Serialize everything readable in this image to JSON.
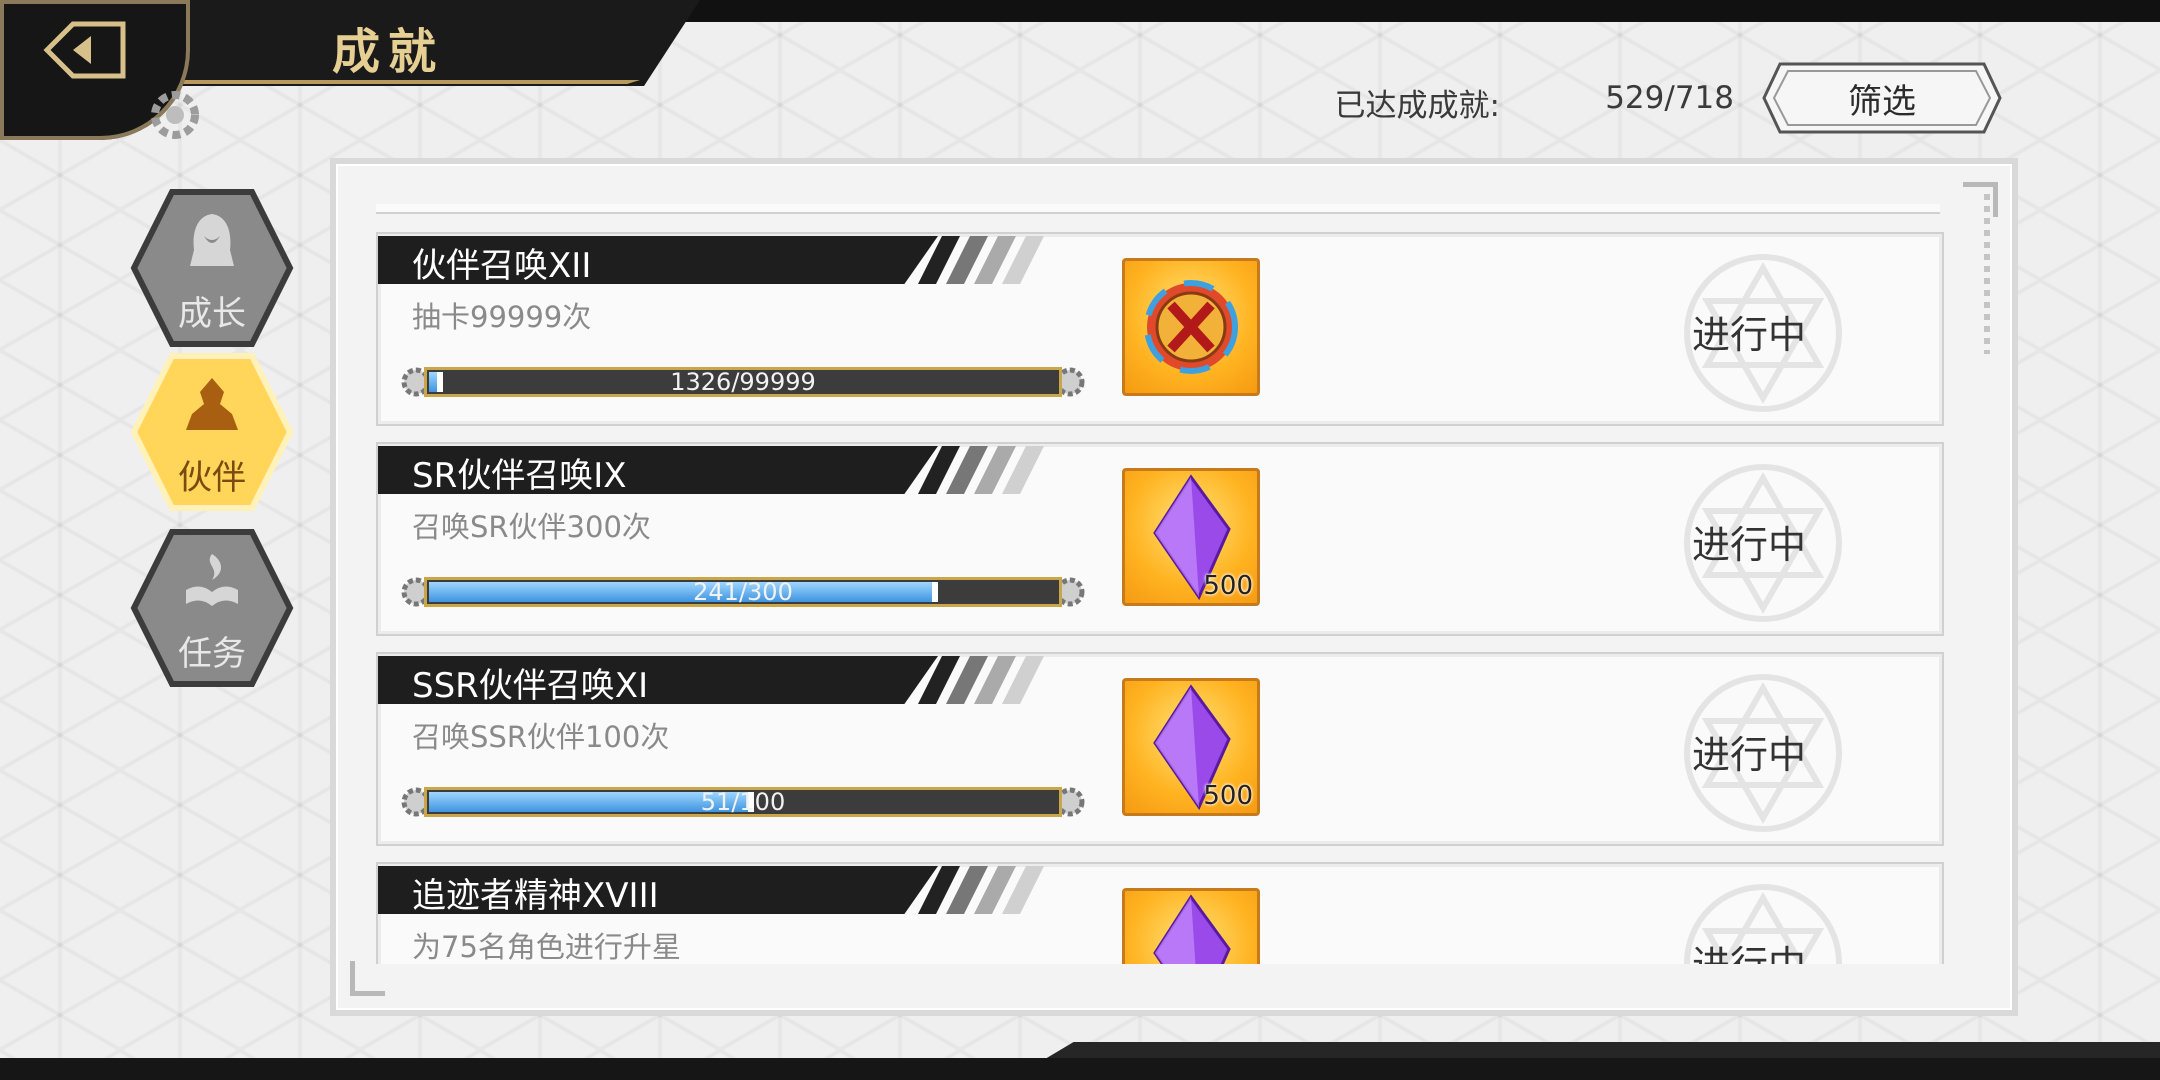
{
  "header": {
    "title": "成就",
    "achievement_label": "已达成成就:",
    "achievement_count": "529/718",
    "filter_label": "筛选"
  },
  "side_tabs": [
    {
      "label": "成长",
      "icon": "hooded-figure-icon",
      "active": false
    },
    {
      "label": "伙伴",
      "icon": "party-group-icon",
      "active": true
    },
    {
      "label": "任务",
      "icon": "book-flame-icon",
      "active": false
    }
  ],
  "achievements": [
    {
      "title": "伙伴召唤XII",
      "desc": "抽卡99999次",
      "progress_text": "1326/99999",
      "progress": 0.013,
      "reward_icon": "rainbow-coin-icon",
      "reward_qty": "",
      "status": "进行中"
    },
    {
      "title": "SR伙伴召唤IX",
      "desc": "召唤SR伙伴300次",
      "progress_text": "241/300",
      "progress": 0.8033,
      "reward_icon": "purple-crystal-icon",
      "reward_qty": "500",
      "status": "进行中"
    },
    {
      "title": "SSR伙伴召唤XI",
      "desc": "召唤SSR伙伴100次",
      "progress_text": "51/100",
      "progress": 0.51,
      "reward_icon": "purple-crystal-icon",
      "reward_qty": "500",
      "status": "进行中"
    },
    {
      "title": "追迹者精神XVIII",
      "desc": "为75名角色进行升星",
      "progress_text": "",
      "progress": 0,
      "reward_icon": "purple-crystal-icon",
      "reward_qty": "",
      "status": "进行中"
    }
  ],
  "colors": {
    "gold": "#c9a64a",
    "title_gold": "#e6cf92",
    "progress_blue": "#3e94e0",
    "reward_orange": "#ffb321",
    "active_tab": "#f5c33b"
  }
}
